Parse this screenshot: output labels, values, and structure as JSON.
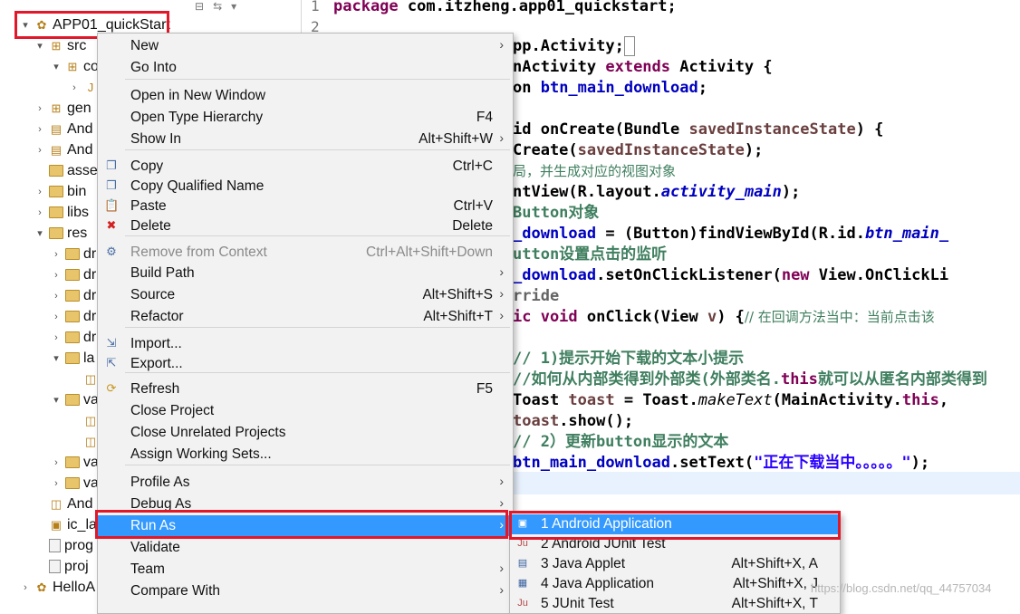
{
  "explorer": {
    "project": "APP01_quickStart",
    "rows": [
      {
        "label": "src",
        "twisty": "▾",
        "icon": "package-folder-icon",
        "indent": 1
      },
      {
        "label": "co",
        "twisty": "▾",
        "icon": "package-icon",
        "indent": 2
      },
      {
        "label": "",
        "twisty": "›",
        "icon": "java-file-icon",
        "indent": 3
      },
      {
        "label": "gen",
        "twisty": "›",
        "icon": "package-folder-icon",
        "indent": 1
      },
      {
        "label": "And",
        "twisty": "›",
        "icon": "library-icon",
        "indent": 1
      },
      {
        "label": "And",
        "twisty": "›",
        "icon": "library-icon",
        "indent": 1
      },
      {
        "label": "asse",
        "twisty": "",
        "icon": "folder-icon",
        "indent": 1
      },
      {
        "label": "bin",
        "twisty": "›",
        "icon": "folder-icon",
        "indent": 1
      },
      {
        "label": "libs",
        "twisty": "›",
        "icon": "folder-icon",
        "indent": 1
      },
      {
        "label": "res",
        "twisty": "▾",
        "icon": "folder-icon",
        "indent": 1
      },
      {
        "label": "dr",
        "twisty": "›",
        "icon": "folder-icon",
        "indent": 2
      },
      {
        "label": "dr",
        "twisty": "›",
        "icon": "folder-icon",
        "indent": 2
      },
      {
        "label": "dr",
        "twisty": "›",
        "icon": "folder-icon",
        "indent": 2
      },
      {
        "label": "dr",
        "twisty": "›",
        "icon": "folder-icon",
        "indent": 2
      },
      {
        "label": "dr",
        "twisty": "›",
        "icon": "folder-icon",
        "indent": 2
      },
      {
        "label": "la",
        "twisty": "▾",
        "icon": "folder-icon",
        "indent": 2
      },
      {
        "label": "",
        "twisty": "",
        "icon": "xml-file-icon",
        "indent": 3
      },
      {
        "label": "va",
        "twisty": "▾",
        "icon": "folder-icon",
        "indent": 2
      },
      {
        "label": "",
        "twisty": "",
        "icon": "xml-file-icon",
        "indent": 3
      },
      {
        "label": "",
        "twisty": "",
        "icon": "xml-file-icon",
        "indent": 3
      },
      {
        "label": "va",
        "twisty": "›",
        "icon": "folder-icon",
        "indent": 2
      },
      {
        "label": "va",
        "twisty": "›",
        "icon": "folder-icon",
        "indent": 2
      },
      {
        "label": "And",
        "twisty": "",
        "icon": "manifest-icon",
        "indent": 1
      },
      {
        "label": "ic_la",
        "twisty": "",
        "icon": "image-file-icon",
        "indent": 1
      },
      {
        "label": "prog",
        "twisty": "",
        "icon": "file-icon",
        "indent": 1
      },
      {
        "label": "proj",
        "twisty": "",
        "icon": "file-icon",
        "indent": 1
      },
      {
        "label": "HelloA",
        "twisty": "›",
        "icon": "project-icon",
        "indent": 0
      }
    ]
  },
  "editor": {
    "line_numbers": [
      "1",
      "2"
    ],
    "line1": {
      "kw": "package",
      "rest": " com.itzheng.app01_quickstart;"
    },
    "line2": {
      "a": "pp.Activity;"
    },
    "line3": {
      "a": "nActivity ",
      "kw": "extends",
      "b": " Activity {"
    },
    "line4": {
      "a": "on ",
      "fld": "btn_main_download",
      "b": ";"
    },
    "line5": {
      "a": "id onCreate(Bundle ",
      "var": "savedInstanceState",
      "b": ") {"
    },
    "line6": {
      "a": "Create(",
      "var": "savedInstanceState",
      "b": ");"
    },
    "line7": {
      "cmt": "局，并生成对应的视图对象"
    },
    "line8": {
      "a": "ntView(R.layout.",
      "fld": "activity_main",
      "b": ");"
    },
    "line9": {
      "cmt": "Button对象"
    },
    "line10": {
      "fld": "_download",
      "a": " = (Button)findViewById(R.id.",
      "fld2": "btn_main_"
    },
    "line11": {
      "cmt": "utton设置点击的监听"
    },
    "line12": {
      "fld": "_download",
      "a": ".setOnClickListener(",
      "kw": "new",
      "b": " View.OnClickLi"
    },
    "line13": {
      "cmt": "rride"
    },
    "line14": {
      "kw": "ic void",
      "a": " onClick(View ",
      "var": "v",
      "b": ") {",
      "cmt": "// 在回调方法当中：当前点击该"
    },
    "line15": {
      "cmt": "// 1)提示开始下载的文本小提示"
    },
    "line16": {
      "cmt": "//如何从内部类得到外部类(外部类名.",
      "kw": "this",
      "cmt2": "就可以从匿名内部类得到"
    },
    "line17": {
      "a": "Toast ",
      "var": "toast",
      "b": " = Toast.",
      "it": "makeText",
      "c": "(MainActivity.",
      "kw": "this",
      "d": ","
    },
    "line18": {
      "var": "toast",
      "a": ".show();"
    },
    "line19": {
      "cmt": "// 2）更新button显示的文本"
    },
    "line20": {
      "fld": "btn_main_download",
      "a": ".setText(",
      "str": "\"正在下载当中。。。。。\"",
      "b": ");"
    }
  },
  "context_menu": {
    "items": [
      {
        "label": "New",
        "shortcut": "",
        "submenu": true,
        "icon": ""
      },
      {
        "label": "Go Into",
        "shortcut": "",
        "submenu": false,
        "icon": ""
      },
      {
        "label": "Open in New Window",
        "shortcut": "",
        "submenu": false,
        "icon": ""
      },
      {
        "label": "Open Type Hierarchy",
        "shortcut": "F4",
        "submenu": false,
        "icon": ""
      },
      {
        "label": "Show In",
        "shortcut": "Alt+Shift+W",
        "submenu": true,
        "icon": ""
      },
      {
        "label": "Copy",
        "shortcut": "Ctrl+C",
        "submenu": false,
        "icon": "copy-icon"
      },
      {
        "label": "Copy Qualified Name",
        "shortcut": "",
        "submenu": false,
        "icon": "copy-qualified-icon"
      },
      {
        "label": "Paste",
        "shortcut": "Ctrl+V",
        "submenu": false,
        "icon": "paste-icon"
      },
      {
        "label": "Delete",
        "shortcut": "Delete",
        "submenu": false,
        "icon": "delete-icon"
      },
      {
        "label": "Remove from Context",
        "shortcut": "Ctrl+Alt+Shift+Down",
        "submenu": false,
        "icon": "remove-context-icon",
        "disabled": true
      },
      {
        "label": "Build Path",
        "shortcut": "",
        "submenu": true,
        "icon": ""
      },
      {
        "label": "Source",
        "shortcut": "Alt+Shift+S",
        "submenu": true,
        "icon": ""
      },
      {
        "label": "Refactor",
        "shortcut": "Alt+Shift+T",
        "submenu": true,
        "icon": ""
      },
      {
        "label": "Import...",
        "shortcut": "",
        "submenu": false,
        "icon": "import-icon"
      },
      {
        "label": "Export...",
        "shortcut": "",
        "submenu": false,
        "icon": "export-icon"
      },
      {
        "label": "Refresh",
        "shortcut": "F5",
        "submenu": false,
        "icon": "refresh-icon"
      },
      {
        "label": "Close Project",
        "shortcut": "",
        "submenu": false,
        "icon": ""
      },
      {
        "label": "Close Unrelated Projects",
        "shortcut": "",
        "submenu": false,
        "icon": ""
      },
      {
        "label": "Assign Working Sets...",
        "shortcut": "",
        "submenu": false,
        "icon": ""
      },
      {
        "label": "Profile As",
        "shortcut": "",
        "submenu": true,
        "icon": ""
      },
      {
        "label": "Debug As",
        "shortcut": "",
        "submenu": true,
        "icon": ""
      },
      {
        "label": "Run As",
        "shortcut": "",
        "submenu": true,
        "icon": "",
        "selected": true
      },
      {
        "label": "Validate",
        "shortcut": "",
        "submenu": false,
        "icon": ""
      },
      {
        "label": "Team",
        "shortcut": "",
        "submenu": true,
        "icon": ""
      },
      {
        "label": "Compare With",
        "shortcut": "",
        "submenu": true,
        "icon": ""
      }
    ]
  },
  "run_as_submenu": {
    "items": [
      {
        "label": "1 Android Application",
        "shortcut": "",
        "icon": "android-app-icon",
        "selected": true
      },
      {
        "label": "2 Android JUnit Test",
        "shortcut": "",
        "icon": "junit-icon"
      },
      {
        "label": "3 Java Applet",
        "shortcut": "Alt+Shift+X, A",
        "icon": "applet-icon"
      },
      {
        "label": "4 Java Application",
        "shortcut": "Alt+Shift+X, J",
        "icon": "java-app-icon"
      },
      {
        "label": "5 JUnit Test",
        "shortcut": "Alt+Shift+X, T",
        "icon": "junit-icon"
      }
    ]
  },
  "watermark": "https://blog.csdn.net/qq_44757034",
  "colors": {
    "highlight": "#3399ff",
    "annotation_box": "#e0182a",
    "keyword": "#7f0055",
    "field": "#0000c0",
    "comment": "#3f7f5f"
  }
}
